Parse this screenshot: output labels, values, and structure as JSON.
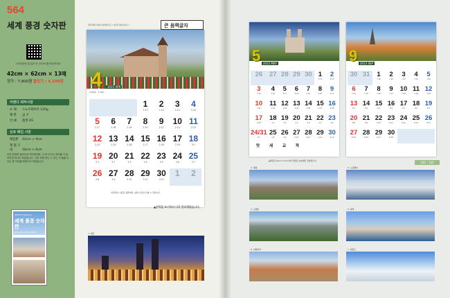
{
  "left_page": {
    "product_number": "564",
    "product_title": "세계 풍경 숫자판",
    "qr_caption": "스마트폰에 앱 설치 후 QR코드를 확인하세요",
    "spec": "42cm × 62cm × 13매",
    "price_label": "정가 : 7,800원",
    "sale_label": "할인가 : 4,200원",
    "sections": [
      {
        "title": "카렌다 제작사양",
        "rows": [
          {
            "key": "소 재",
            "value": "스노우화이트 120g"
          },
          {
            "key": "제 본",
            "value": "금 구"
          },
          {
            "key": "인 쇄",
            "value": "옵셋 4도"
          }
        ]
      },
      {
        "title": "상호 배입 사양",
        "rows": [
          {
            "key": "배입판",
            "value": "42cm × 9cm"
          },
          {
            "key": "책 접 구 내",
            "value": "34cm × 6cm"
          }
        ]
      }
    ],
    "note": "자연 만세력 달력으로 역사적이며, 가 조 이거나 과거를 이 잘 보이게 하기도 하였습니다. 사진 서에 보는 그 주는 이 들을 수 있는 형 자연을 배경으로 하였습니다.",
    "thumbnail": {
      "brand": "PHOTO Calendar",
      "title": "세계 풍경 숫자판",
      "subtitle": "Scenery of the World"
    },
    "label_box": "큰 음력글자",
    "calendar_top_caption": "달력 배경 이미지 설명입니다. (사진은 예시입니다.)",
    "calendar_caption": "이미지의 사진은 샘플이며, 실제 사진과 다를 수 있습니다.",
    "calendar_footnote": "▲한쪽을 포기하지 더욱 편리해졌습니다.",
    "panorama_label": "1. 체코",
    "april": {
      "month": "4",
      "label": "2015 APR",
      "mini_months": "3 MAR · 5 MAY",
      "days": [
        {
          "d": "",
          "l": ""
        },
        {
          "d": "",
          "l": ""
        },
        {
          "d": "",
          "l": ""
        },
        {
          "d": "1",
          "l": "2.13"
        },
        {
          "d": "2",
          "l": "2.14"
        },
        {
          "d": "3",
          "l": "2.15"
        },
        {
          "d": "4",
          "l": "2.16"
        },
        {
          "d": "5",
          "l": "2.17"
        },
        {
          "d": "6",
          "l": "2.18"
        },
        {
          "d": "7",
          "l": "2.19"
        },
        {
          "d": "8",
          "l": "2.20"
        },
        {
          "d": "9",
          "l": "2.21"
        },
        {
          "d": "10",
          "l": "2.22"
        },
        {
          "d": "11",
          "l": "2.23"
        },
        {
          "d": "12",
          "l": "2.24"
        },
        {
          "d": "13",
          "l": "2.25"
        },
        {
          "d": "14",
          "l": "2.26"
        },
        {
          "d": "15",
          "l": "2.27"
        },
        {
          "d": "16",
          "l": "2.28"
        },
        {
          "d": "17",
          "l": "2.29"
        },
        {
          "d": "18",
          "l": "3.1"
        },
        {
          "d": "19",
          "l": "3.1"
        },
        {
          "d": "20",
          "l": "3.2"
        },
        {
          "d": "21",
          "l": "3.3"
        },
        {
          "d": "22",
          "l": "3.4"
        },
        {
          "d": "23",
          "l": "3.5"
        },
        {
          "d": "24",
          "l": "3.6"
        },
        {
          "d": "25",
          "l": "3.7"
        },
        {
          "d": "26",
          "l": "3.8"
        },
        {
          "d": "27",
          "l": "3.9"
        },
        {
          "d": "28",
          "l": "3.10"
        },
        {
          "d": "29",
          "l": "3.11"
        },
        {
          "d": "30",
          "l": "3.12"
        },
        {
          "d": "1",
          "l": ""
        },
        {
          "d": "2",
          "l": ""
        }
      ]
    }
  },
  "right_page": {
    "may": {
      "month": "5",
      "label": "2015 MAY",
      "days": [
        {
          "d": "26",
          "l": ""
        },
        {
          "d": "27",
          "l": ""
        },
        {
          "d": "28",
          "l": ""
        },
        {
          "d": "29",
          "l": ""
        },
        {
          "d": "30",
          "l": ""
        },
        {
          "d": "1",
          "l": "3.13"
        },
        {
          "d": "2",
          "l": "3.14"
        },
        {
          "d": "3",
          "l": "3.15"
        },
        {
          "d": "4",
          "l": "3.16"
        },
        {
          "d": "5",
          "l": "3.17"
        },
        {
          "d": "6",
          "l": "3.18"
        },
        {
          "d": "7",
          "l": "3.19"
        },
        {
          "d": "8",
          "l": "3.20"
        },
        {
          "d": "9",
          "l": "3.21"
        },
        {
          "d": "10",
          "l": "3.22"
        },
        {
          "d": "11",
          "l": "3.23"
        },
        {
          "d": "12",
          "l": "3.24"
        },
        {
          "d": "13",
          "l": "3.25"
        },
        {
          "d": "14",
          "l": "3.26"
        },
        {
          "d": "15",
          "l": "3.27"
        },
        {
          "d": "16",
          "l": "3.28"
        },
        {
          "d": "17",
          "l": "3.29"
        },
        {
          "d": "18",
          "l": "4.1"
        },
        {
          "d": "19",
          "l": "4.2"
        },
        {
          "d": "20",
          "l": "4.3"
        },
        {
          "d": "21",
          "l": "4.4"
        },
        {
          "d": "22",
          "l": "4.5"
        },
        {
          "d": "23",
          "l": "4.6"
        },
        {
          "d": "24/31",
          "l": "4.7"
        },
        {
          "d": "25",
          "l": "4.8"
        },
        {
          "d": "26",
          "l": "4.9"
        },
        {
          "d": "27",
          "l": "4.10"
        },
        {
          "d": "28",
          "l": "4.11"
        },
        {
          "d": "29",
          "l": "4.12"
        },
        {
          "d": "30",
          "l": "4.13"
        }
      ],
      "brand": "맛 세 교 적"
    },
    "september": {
      "month": "9",
      "label": "2015 SEP",
      "days": [
        {
          "d": "30",
          "l": ""
        },
        {
          "d": "31",
          "l": ""
        },
        {
          "d": "1",
          "l": "7.19"
        },
        {
          "d": "2",
          "l": "7.20"
        },
        {
          "d": "3",
          "l": "7.21"
        },
        {
          "d": "4",
          "l": "7.22"
        },
        {
          "d": "5",
          "l": "7.23"
        },
        {
          "d": "6",
          "l": "7.24"
        },
        {
          "d": "7",
          "l": "7.25"
        },
        {
          "d": "8",
          "l": "7.26"
        },
        {
          "d": "9",
          "l": "7.27"
        },
        {
          "d": "10",
          "l": "7.28"
        },
        {
          "d": "11",
          "l": "7.29"
        },
        {
          "d": "12",
          "l": "7.30"
        },
        {
          "d": "13",
          "l": "8.1"
        },
        {
          "d": "14",
          "l": "8.2"
        },
        {
          "d": "15",
          "l": "8.3"
        },
        {
          "d": "16",
          "l": "8.4"
        },
        {
          "d": "17",
          "l": "8.5"
        },
        {
          "d": "18",
          "l": "8.6"
        },
        {
          "d": "19",
          "l": "8.7"
        },
        {
          "d": "20",
          "l": "8.8"
        },
        {
          "d": "21",
          "l": "8.9"
        },
        {
          "d": "22",
          "l": "8.10"
        },
        {
          "d": "23",
          "l": "8.11"
        },
        {
          "d": "24",
          "l": "8.12"
        },
        {
          "d": "25",
          "l": "8.13"
        },
        {
          "d": "26",
          "l": "8.14"
        },
        {
          "d": "27",
          "l": "8.15"
        },
        {
          "d": "28",
          "l": "8.16"
        },
        {
          "d": "29",
          "l": "8.17"
        },
        {
          "d": "30",
          "l": "8.18"
        },
        {
          "d": "",
          "l": ""
        },
        {
          "d": "",
          "l": ""
        },
        {
          "d": "",
          "l": ""
        }
      ]
    },
    "calendar_caption": "▲책접구(34cm×6cm)에 작업한 상호배입 견본입니다.",
    "page_numbers": "142 · 143",
    "photo_labels": [
      "2. 독일",
      "3. 노르웨이",
      "4. 스페인",
      "5. 영국",
      "6. 이탈리아",
      "7. 핀란드"
    ]
  }
}
